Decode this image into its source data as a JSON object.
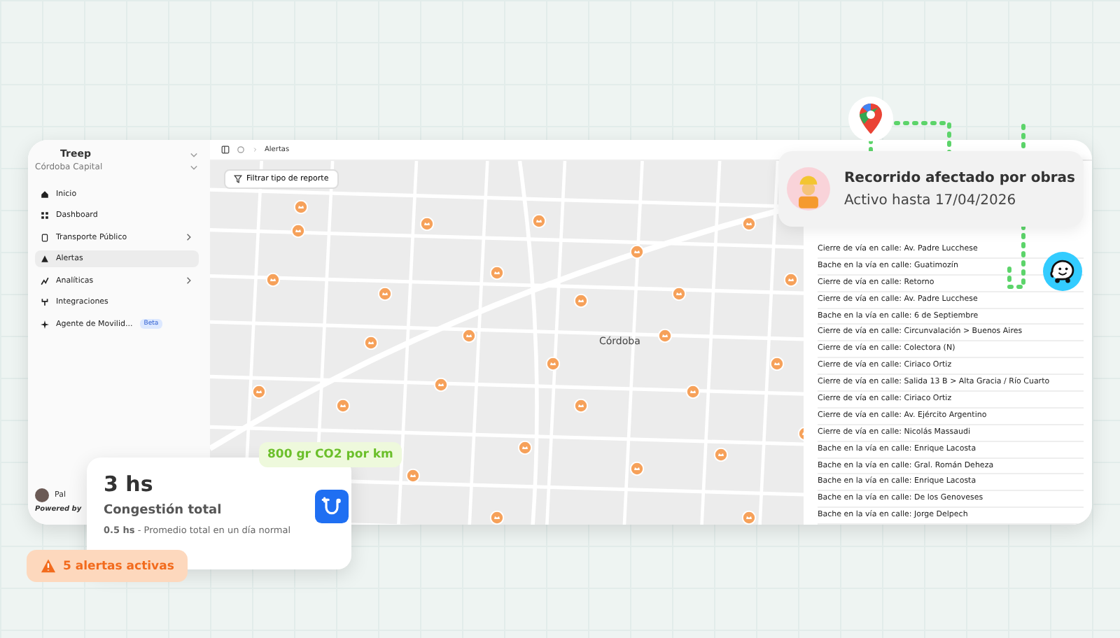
{
  "sidebar": {
    "app_name": "Treep",
    "city": "Córdoba Capital",
    "items": [
      {
        "label": "Inicio",
        "selected": false,
        "expandable": false
      },
      {
        "label": "Dashboard",
        "selected": false,
        "expandable": false
      },
      {
        "label": "Transporte Público",
        "selected": false,
        "expandable": true
      },
      {
        "label": "Alertas",
        "selected": true,
        "expandable": false
      },
      {
        "label": "Analíticas",
        "selected": false,
        "expandable": true
      },
      {
        "label": "Integraciones",
        "selected": false,
        "expandable": false
      },
      {
        "label": "Agente de Movilid...",
        "selected": false,
        "expandable": false,
        "badge": "Beta"
      }
    ],
    "user": "Pal",
    "footer": "Powered by"
  },
  "breadcrumb": "Alertas",
  "map": {
    "filter_button": "Filtrar tipo de reporte",
    "city_label": "Córdoba"
  },
  "reports": [
    {
      "text": "Cierre de vía en calle: Av. Padre Lucchese"
    },
    {
      "text": "Bache en la vía en calle: Guatimozín"
    },
    {
      "text": "Cierre de vía en calle: Retorno"
    },
    {
      "text": "Cierre de vía en calle: Av. Padre Lucchese"
    },
    {
      "text": "Bache en la vía en calle: 6 de Septiembre"
    },
    {
      "text": "Cierre de vía en calle: Circunvalación > Buenos Aires"
    },
    {
      "text": "Cierre de vía en calle: Colectora (N)"
    },
    {
      "text": "Cierre de vía en calle: Ciriaco Ortiz"
    },
    {
      "text": "Cierre de vía en calle: Salida 13 B > Alta Gracia / Río Cuarto"
    },
    {
      "text": "Cierre de vía en calle: Ciriaco Ortiz"
    },
    {
      "text": "Cierre de vía en calle: Av. Ejército Argentino"
    },
    {
      "text": "Cierre de vía en calle: Nicolás Massaudi"
    },
    {
      "text": "Bache en la vía en calle: Enrique Lacosta"
    },
    {
      "text": "Bache en la vía en calle: Gral. Román Deheza"
    },
    {
      "text": "Bache en la vía en calle: Enrique Lacosta"
    },
    {
      "text": "Bache en la vía en calle: De los Genoveses"
    },
    {
      "text": "Bache en la vía en calle: Jorge Delpech"
    }
  ],
  "works_card": {
    "title": "Recorrido afectado por obras",
    "subtitle": "Activo hasta 17/04/2026"
  },
  "congestion_card": {
    "value": "3 hs",
    "title": "Congestión total",
    "note": "**0.5 hs** - Promedio total en un día normal"
  },
  "emission_badge": "800 gr CO2 por km",
  "alerts_badge": "5 alertas activas"
}
